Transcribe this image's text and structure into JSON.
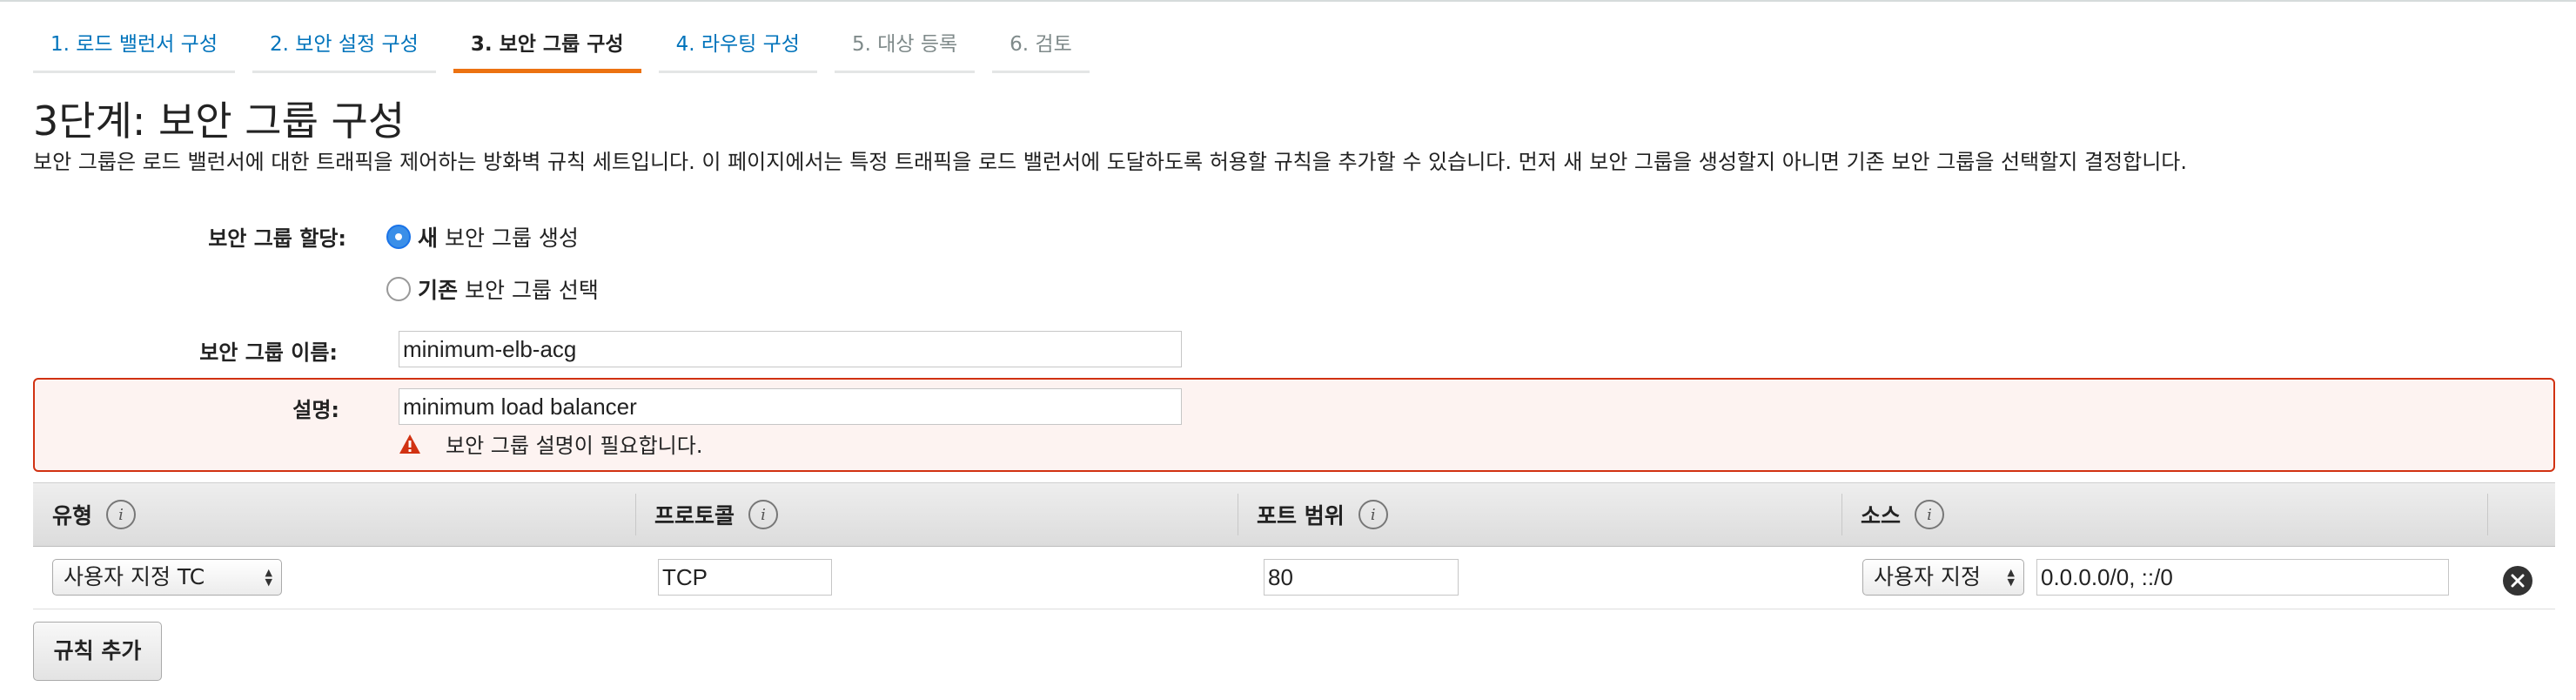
{
  "wizard": {
    "tabs": [
      {
        "label": "1. 로드 밸런서 구성",
        "state": "link"
      },
      {
        "label": "2. 보안 설정 구성",
        "state": "link"
      },
      {
        "label": "3. 보안 그룹 구성",
        "state": "active"
      },
      {
        "label": "4. 라우팅 구성",
        "state": "link"
      },
      {
        "label": "5. 대상 등록",
        "state": "disabled"
      },
      {
        "label": "6. 검토",
        "state": "disabled"
      }
    ]
  },
  "page": {
    "title": "3단계: 보안 그룹 구성",
    "description": "보안 그룹은 로드 밸런서에 대한 트래픽을 제어하는 방화벽 규칙 세트입니다. 이 페이지에서는 특정 트래픽을 로드 밸런서에 도달하도록 허용할 규칙을 추가할 수 있습니다. 먼저 새 보안 그룹을 생성할지 아니면 기존 보안 그룹을 선택할지 결정합니다."
  },
  "form": {
    "assign_label": "보안 그룹 할당:",
    "options": [
      {
        "bold": "새",
        "rest": "보안 그룹 생성",
        "checked": true
      },
      {
        "bold": "기존",
        "rest": "보안 그룹 선택",
        "checked": false
      }
    ],
    "name_label": "보안 그룹 이름:",
    "name_value": "minimum-elb-acg",
    "desc_label": "설명:",
    "desc_value": "minimum load balancer",
    "desc_error": "보안 그룹 설명이 필요합니다."
  },
  "rules": {
    "columns": [
      "유형",
      "프로토콜",
      "포트 범위",
      "소스"
    ],
    "info_glyph": "i",
    "rows": [
      {
        "type": "사용자 지정 TC",
        "protocol": "TCP",
        "port_range": "80",
        "source_type": "사용자 지정",
        "source_cidr": "0.0.0.0/0, ::/0"
      }
    ],
    "add_rule_label": "규칙 추가"
  },
  "colors": {
    "link": "#0073bb",
    "active_tab_underline": "#ec7211",
    "error_border": "#d13212",
    "error_background": "#fdf3f1",
    "radio_checked": "#3b8fe8"
  },
  "icons": {
    "warning": "warning-triangle-icon",
    "info": "info-icon",
    "remove": "close-circle-icon",
    "select_arrows": "up-down-arrows-icon"
  }
}
